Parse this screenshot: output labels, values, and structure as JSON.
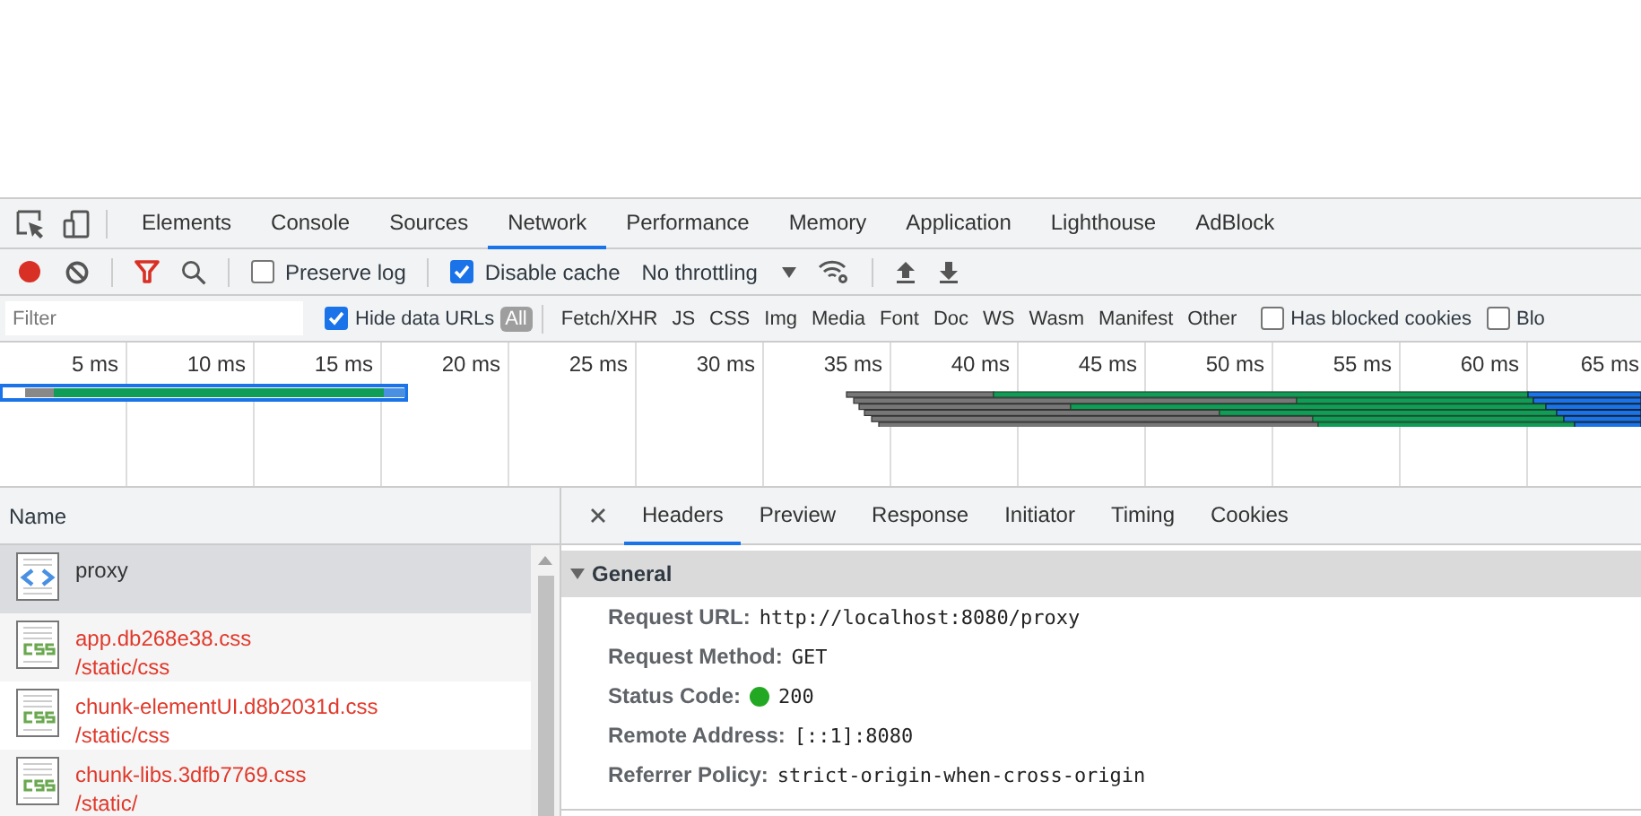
{
  "tab_bar": {
    "tabs": [
      {
        "label": "Elements",
        "selected": false
      },
      {
        "label": "Console",
        "selected": false
      },
      {
        "label": "Sources",
        "selected": false
      },
      {
        "label": "Network",
        "selected": true
      },
      {
        "label": "Performance",
        "selected": false
      },
      {
        "label": "Memory",
        "selected": false
      },
      {
        "label": "Application",
        "selected": false
      },
      {
        "label": "Lighthouse",
        "selected": false
      },
      {
        "label": "AdBlock",
        "selected": false
      }
    ]
  },
  "toolbar": {
    "recording": true,
    "preserve_log": {
      "label": "Preserve log",
      "checked": false
    },
    "disable_cache": {
      "label": "Disable cache",
      "checked": true
    },
    "throttling": "No throttling"
  },
  "filter_bar": {
    "filter": {
      "placeholder": "Filter"
    },
    "hide_data_urls": {
      "label": "Hide data URLs",
      "checked": true
    },
    "types": [
      {
        "label": "All",
        "selected": true
      },
      {
        "label": "Fetch/XHR",
        "selected": false
      },
      {
        "label": "JS",
        "selected": false
      },
      {
        "label": "CSS",
        "selected": false
      },
      {
        "label": "Img",
        "selected": false
      },
      {
        "label": "Media",
        "selected": false
      },
      {
        "label": "Font",
        "selected": false
      },
      {
        "label": "Doc",
        "selected": false
      },
      {
        "label": "WS",
        "selected": false
      },
      {
        "label": "Wasm",
        "selected": false
      },
      {
        "label": "Manifest",
        "selected": false
      },
      {
        "label": "Other",
        "selected": false
      }
    ],
    "blocked_cookies": {
      "label": "Has blocked cookies",
      "checked": false
    },
    "blocked_requests": {
      "label": "Blo",
      "checked": false
    }
  },
  "overview": {
    "ticks": [
      "5 ms",
      "10 ms",
      "15 ms",
      "20 ms",
      "25 ms",
      "30 ms",
      "35 ms",
      "40 ms",
      "45 ms",
      "50 ms",
      "55 ms",
      "60 ms",
      "65 ms"
    ]
  },
  "requests": {
    "column": "Name",
    "rows": [
      {
        "kind": "document",
        "name": "proxy",
        "selected": true,
        "failed": false
      },
      {
        "kind": "stylesheet",
        "name": "app.db268e38.css",
        "path": "/static/css",
        "selected": false,
        "failed": true
      },
      {
        "kind": "stylesheet",
        "name": "chunk-elementUI.d8b2031d.css",
        "path": "/static/css",
        "selected": false,
        "failed": true
      },
      {
        "kind": "stylesheet",
        "name": "chunk-libs.3dfb7769.css",
        "path": "/static/",
        "selected": false,
        "failed": true
      }
    ]
  },
  "details": {
    "tabs": [
      {
        "label": "Headers",
        "selected": true
      },
      {
        "label": "Preview",
        "selected": false
      },
      {
        "label": "Response",
        "selected": false
      },
      {
        "label": "Initiator",
        "selected": false
      },
      {
        "label": "Timing",
        "selected": false
      },
      {
        "label": "Cookies",
        "selected": false
      }
    ],
    "section": {
      "title": "General",
      "expanded": true,
      "rows": [
        {
          "key": "Request URL:",
          "value": "http://localhost:8080/proxy"
        },
        {
          "key": "Request Method:",
          "value": "GET"
        },
        {
          "key": "Status Code:",
          "value": "200",
          "color": "#22a822"
        },
        {
          "key": "Remote Address:",
          "value": "[::1]:8080"
        },
        {
          "key": "Referrer Policy:",
          "value": "strict-origin-when-cross-origin"
        }
      ]
    }
  }
}
